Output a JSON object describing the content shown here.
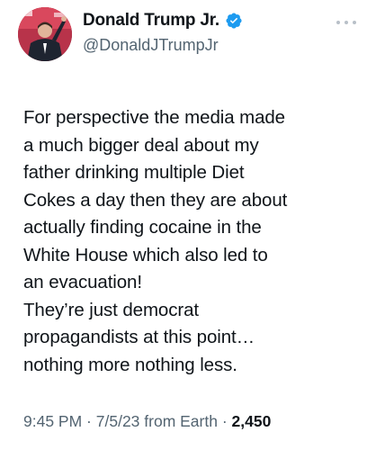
{
  "author": {
    "display_name": "Donald Trump Jr.",
    "handle": "@DonaldJTrumpJr",
    "verified_icon": "verified-badge-icon",
    "verified_color": "#1d9bf0"
  },
  "menu_icon": "more-options-icon",
  "tweet": {
    "lines": [
      "For perspective the media made",
      "a much bigger deal about my",
      "father drinking multiple Diet",
      "Cokes a day then they are about",
      "actually finding cocaine in the",
      "White House which also led to",
      "an evacuation!",
      "They’re just democrat",
      "propagandists at this point…",
      "nothing more nothing less."
    ]
  },
  "meta": {
    "time": "9:45 PM",
    "sep1": " · ",
    "date": "7/5/23",
    "source": " from Earth",
    "sep2": " · ",
    "views": "2,450"
  }
}
